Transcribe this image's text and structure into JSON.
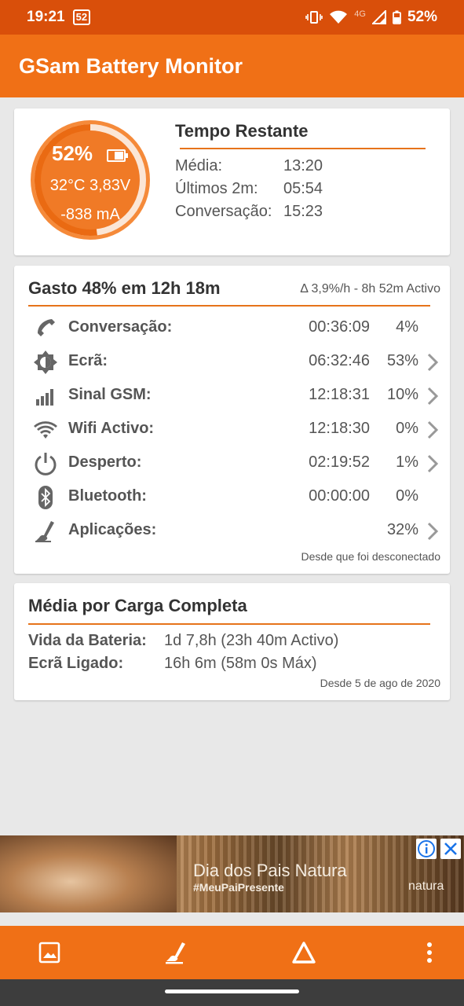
{
  "status_bar": {
    "time": "19:21",
    "notification": "52",
    "network": "4G",
    "battery": "52%"
  },
  "app_title": "GSam Battery Monitor",
  "gauge": {
    "percent": "52%",
    "level": 0.52,
    "temp_voltage": "32°C  3,83V",
    "current": "-838 mA"
  },
  "remaining": {
    "title": "Tempo Restante",
    "rows": [
      {
        "label": "Média:",
        "value": "13:20"
      },
      {
        "label": "Últimos 2m:",
        "value": "05:54"
      },
      {
        "label": "Conversação:",
        "value": "15:23"
      }
    ]
  },
  "usage": {
    "title": "Gasto 48% em 12h 18m",
    "rate": "Δ 3,9%/h - 8h 52m Activo",
    "rows": [
      {
        "icon": "phone-icon",
        "label": "Conversação:",
        "time": "00:36:09",
        "percent": "4%"
      },
      {
        "icon": "brightness-icon",
        "label": "Ecrã:",
        "time": "06:32:46",
        "percent": "53%"
      },
      {
        "icon": "signal-icon",
        "label": "Sinal GSM:",
        "time": "12:18:31",
        "percent": "10%"
      },
      {
        "icon": "wifi-icon",
        "label": "Wifi Activo:",
        "time": "12:18:30",
        "percent": "0%"
      },
      {
        "icon": "power-icon",
        "label": "Desperto:",
        "time": "02:19:52",
        "percent": "1%"
      },
      {
        "icon": "bluetooth-icon",
        "label": "Bluetooth:",
        "time": "00:00:00",
        "percent": "0%"
      },
      {
        "icon": "apps-icon",
        "label": "Aplicações:",
        "time": "",
        "percent": "32%"
      }
    ],
    "footer": "Desde que foi desconectado"
  },
  "full_charge": {
    "title": "Média por Carga Completa",
    "rows": [
      {
        "label": "Vida da Bateria:",
        "value": "1d 7,8h (23h 40m Activo)"
      },
      {
        "label": "Ecrã Ligado:",
        "value": "16h 6m (58m 0s Máx)"
      }
    ],
    "footer": "Desde 5 de ago de 2020"
  },
  "ad": {
    "headline": "Dia dos Pais Natura",
    "hashtag": "#MeuPaiPresente",
    "brand": "natura"
  },
  "colors": {
    "status_bar": "#d94f0a",
    "app_bar": "#f07016",
    "accent": "#e6731a"
  }
}
